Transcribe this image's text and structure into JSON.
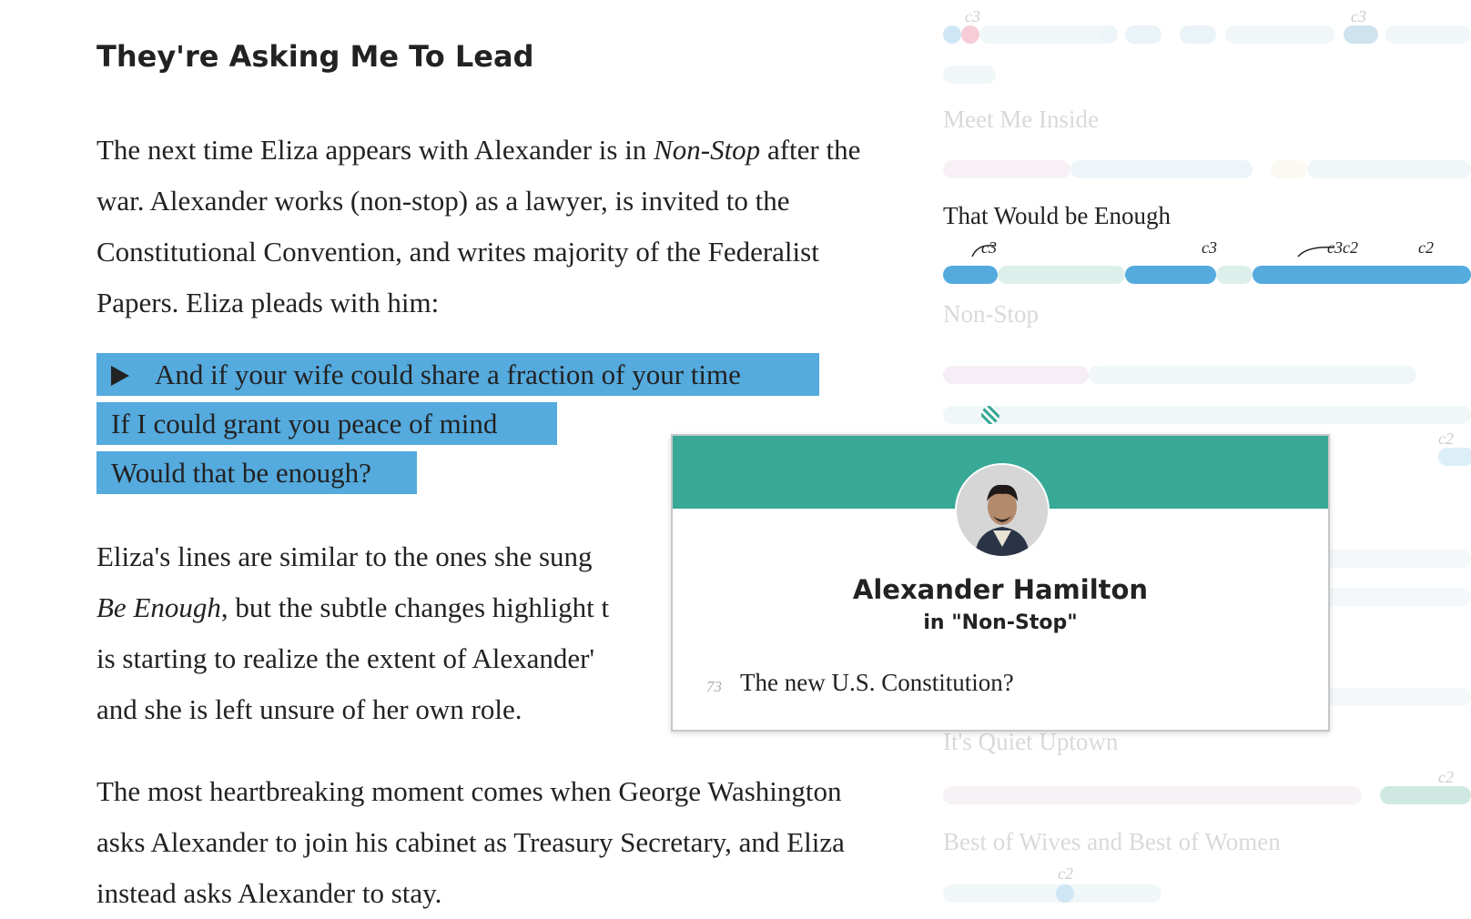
{
  "article": {
    "heading": "They're Asking Me To Lead",
    "p1": {
      "a": "The next time Eliza appears with Alexander is in ",
      "em": "Non-Stop",
      "b": " after the war. Alexander works (non-stop) as a lawyer, is invited to the Constitutional Convention, and writes majority of the Federalist Papers. Eliza pleads with him:"
    },
    "lyrics": [
      "And if your wife could share a fraction of your time",
      "If I could grant you peace of mind",
      "Would that be enough?"
    ],
    "p2": {
      "a": "Eliza's lines are similar to the ones she sung ",
      "em": "Be Enough",
      "b": ", but the subtle changes highlight t",
      "c": "is starting to realize the extent of Alexander'",
      "d": "and she is left unsure of her own role."
    },
    "p3": "The most heartbreaking moment comes when George Washington asks Alexander to join his cabinet as Treasury Secretary, and Eliza instead asks Alexander to stay."
  },
  "viz": {
    "songs": [
      {
        "title": "Meet Me Inside",
        "active": false
      },
      {
        "title": "That Would be Enough",
        "active": true
      },
      {
        "title": "Non-Stop",
        "active": false
      },
      {
        "title": "It's Quiet Uptown",
        "active": false
      },
      {
        "title": "Best of Wives and Best of Women",
        "active": false
      }
    ],
    "tags": [
      "c3",
      "c3",
      "c3",
      "c3",
      "c3c2",
      "c2",
      "c2",
      "c2",
      "c2"
    ]
  },
  "popup": {
    "name": "Alexander Hamilton",
    "subtitle": "in \"Non-Stop\"",
    "line_number": "73",
    "line": "The new U.S. Constitution?",
    "band_color": "#37a996"
  },
  "colors": {
    "highlight": "#55aade",
    "accent": "#37a996"
  }
}
